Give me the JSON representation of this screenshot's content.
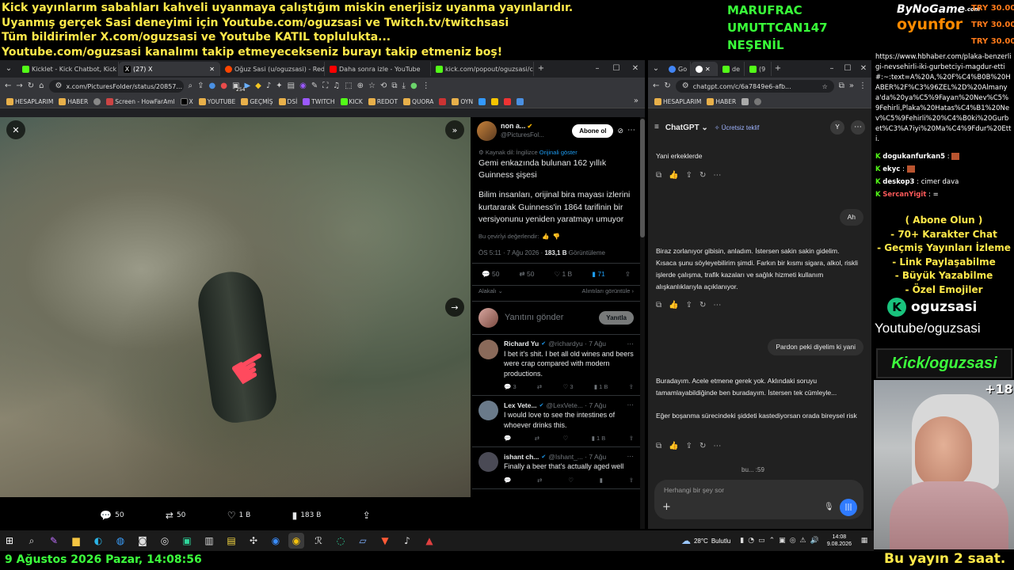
{
  "overlay": {
    "lines": [
      "Kick yayınlarım sabahları kahveli uyanmaya çalıştığım miskin enerjisiz uyanma yayınlarıdır.",
      "Uyanmış gerçek Sasi deneyimi için Youtube.com/oguzsasi ve Twitch.tv/twitchsasi",
      "Tüm bildirimler X.com/oguzsasi ve Youtube KATIL toplulukta...",
      "Youtube.com/oguzsasi kanalımı takip etmeyecekseniz burayı takip etmeniz boş!"
    ],
    "donors": [
      "MARUFRAC",
      "UMUTTCAN147",
      "NEŞENİL"
    ],
    "brand_top": "ByNoGame",
    "brand_top_suffix": ".com",
    "brand_bottom": "oyunfor",
    "try": [
      "TRY 30.00",
      "TRY 30.00",
      "TRY 30.00"
    ],
    "date": "9 Ağustos 2026 Pazar, 14:08:56",
    "bottom_right": "Bu yayın 2 saat."
  },
  "chat": {
    "link": "https://www.hbhaber.com/plaka-benzerligi-nevsehirli-iki-gurbetciyi-magdur-etti#:~:text=A%20A,%20F%C4%B0B%20HABER%2F%C3%96ZEL%2D%20Almanya'da%20ya%C5%9Fayan%20Nev%C5%9Fehirli,Plaka%20Hatas%C4%B1%20Nev%C5%9Fehirli%20%C4%B0ki%20Gurbet%C3%A7iyi%20Ma%C4%9Fdur%20Etti.",
    "messages": [
      {
        "user": "dogukanfurkan5",
        "text": " : ",
        "color": "#ffffff",
        "emote": true
      },
      {
        "user": "ekyc",
        "text": " : ",
        "color": "#ffffff",
        "emote": true
      },
      {
        "user": "deskop3",
        "text": " : cimer dava",
        "color": "#ffffff",
        "emote": false
      },
      {
        "user": "SercanYigit",
        "text": " : =",
        "color": "#ff5a5a",
        "emote": false
      }
    ],
    "promo": [
      "( Abone Olun )",
      "- 70+ Karakter Chat",
      "- Geçmiş Yayınları İzleme",
      "- Link Paylaşabilme",
      "- Büyük Yazabilme",
      "- Özel Emojiler"
    ],
    "kick_user": "oguzsasi",
    "yt": "Youtube/oguzsasi",
    "kick_banner": "Kick/oguzsasi",
    "plus": "+18"
  },
  "browser_left": {
    "tabs": [
      {
        "label": "Kicklet - Kick Chatbot, Kick W",
        "color": "#53fc18"
      },
      {
        "label": "(27) X",
        "color": "#ffffff"
      },
      {
        "label": "Oğuz Sasi (u/oguzsasi) - Redd",
        "color": "#ff4500"
      },
      {
        "label": "Daha sonra izle - YouTube",
        "color": "#ff0000"
      },
      {
        "label": "kick.com/popout/oguzsasi/ch",
        "color": "#53fc18"
      }
    ],
    "url": "x.com/PicturesFolder/status/20857...",
    "bookmarks": [
      "HESAPLARIM",
      "HABER",
      "Screen - HowFarAml",
      "X",
      "YOUTUBE",
      "GEÇMİŞ",
      "DSİ",
      "TWITCH",
      "KICK",
      "REDOT",
      "QUORA",
      "OYN"
    ],
    "badge": "254"
  },
  "tweet": {
    "author": "non a...",
    "handle": "@PicturesFol...",
    "follow": "Abone ol",
    "translated_from": "Kaynak dil: İngilizce",
    "show_original": "Orijinali göster",
    "title": "Gemi enkazında bulunan 162 yıllık Guinness şişesi",
    "body": "Bilim insanları, orijinal bira mayası izlerini kurtararak Guinness'in 1864 tarifinin bir versiyonunu yeniden yaratmayı umuyor",
    "rate": "Bu çevirîyi değerlendir:",
    "time": "ÖS 5:11 · 7 Ağu 2026 ·",
    "views": "183,1 B",
    "views_label": "Görüntüleme",
    "stats": {
      "replies": "50",
      "retweets": "50",
      "likes": "1 B",
      "bookmarks": "71"
    },
    "related": "Alakalı",
    "quotes": "Alıntıları görüntüle",
    "reply_placeholder": "Yanıtını gönder",
    "reply_button": "Yanıtla",
    "media_stats": {
      "replies": "50",
      "retweets": "50",
      "likes": "1 B",
      "views": "183 B"
    },
    "replies": [
      {
        "name": "Richard Yu",
        "handle": "@richardyu · 7 Ağu",
        "text": "I bet it's shit. I bet all old wines and beers were crap compared with modern productions.",
        "r": "3",
        "rt": "",
        "l": "3",
        "v": "1 B",
        "color": "#8a6a5a"
      },
      {
        "name": "Lex Vete...",
        "handle": "@LexVete... · 7 Ağu",
        "text": "I would love to see the intestines of whoever drinks this.",
        "r": "",
        "rt": "",
        "l": "",
        "v": "1 B",
        "color": "#6a7a8a"
      },
      {
        "name": "ishant ch...",
        "handle": "@Ishant_... · 7 Ağu",
        "text": "Finally a beer that's actually aged well",
        "r": "",
        "rt": "",
        "l": "",
        "v": "",
        "color": "#4a4a55"
      }
    ]
  },
  "browser_right": {
    "tabs": [
      "Go",
      "",
      "de",
      "(9"
    ],
    "url": "chatgpt.com/c/6a7849e6-afb...",
    "bookmarks": [
      "HESAPLARIM",
      "HABER"
    ],
    "app": "ChatGPT",
    "free": "Ücretsiz teklif",
    "messages": [
      {
        "role": "assistant",
        "text": "Yani erkeklerde"
      },
      {
        "role": "user",
        "text": "Ah"
      },
      {
        "role": "assistant",
        "text": "Biraz zorlanıyor gibisin, anladım. İstersen sakin sakin gidelim. Kısaca şunu söyleyebilirim şimdi. Farkın bir kısmı sigara, alkol, riskli işlerde çalışma, trafik kazaları ve sağlık hizmeti kullanım alışkanlıklarıyla açıklanıyor."
      },
      {
        "role": "user",
        "text": "Pardon peki diyelim ki yani"
      },
      {
        "role": "assistant",
        "text": "Buradayım. Acele etmene gerek yok. Aklındaki soruyu tamamlayabildiğinde ben buradayım. İstersen tek cümleyle..."
      },
      {
        "role": "assistant",
        "text": "Eğer boşanma sürecindeki şiddeti kastediyorsan orada bireysel risk"
      }
    ],
    "status": "bu... :59",
    "input_placeholder": "Herhangi bir şey sor"
  },
  "taskbar": {
    "weather": "28°C",
    "weather_label": "Bulutlu",
    "time": "14:08",
    "date": "9.08.2026"
  }
}
